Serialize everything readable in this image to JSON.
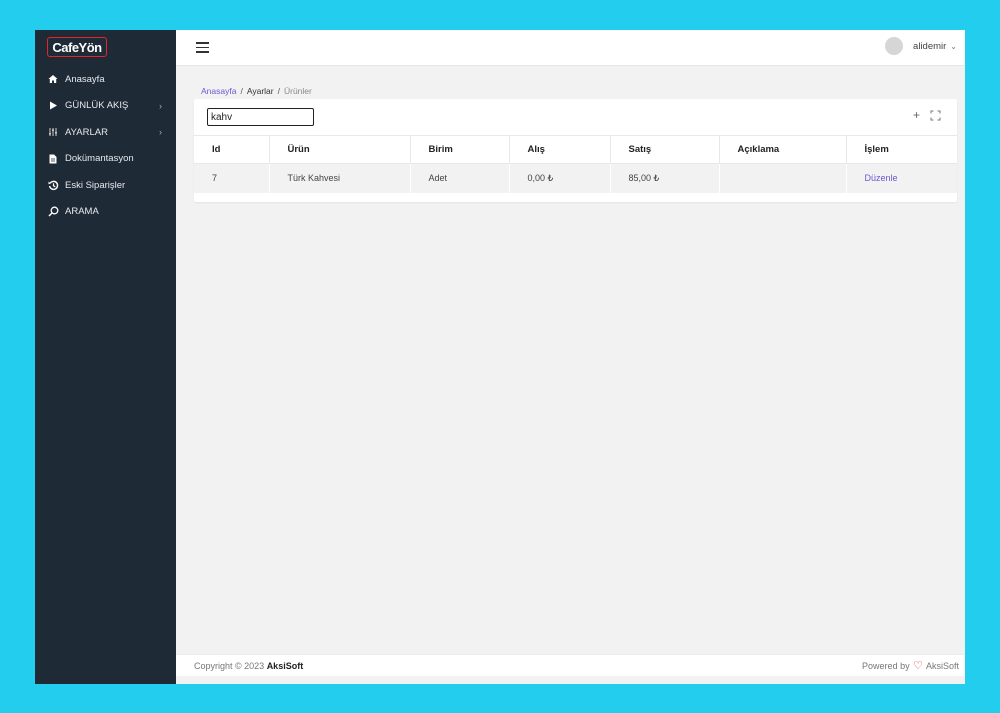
{
  "brand": {
    "logo_text": "CafeYön"
  },
  "sidebar": {
    "items": [
      {
        "label": "Anasayfa",
        "icon": "home-icon",
        "chevron": ""
      },
      {
        "label": "GÜNLÜK AKIŞ",
        "icon": "play-icon",
        "chevron": "›"
      },
      {
        "label": "AYARLAR",
        "icon": "sliders-icon",
        "chevron": "›"
      },
      {
        "label": "Dokümantasyon",
        "icon": "document-icon",
        "chevron": ""
      },
      {
        "label": "Eski Siparişler",
        "icon": "history-icon",
        "chevron": ""
      },
      {
        "label": "ARAMA",
        "icon": "search-icon",
        "chevron": ""
      }
    ]
  },
  "topbar": {
    "username": "alidemir",
    "caret": "⌄"
  },
  "breadcrumb": {
    "home": "Anasayfa",
    "settings": "Ayarlar",
    "current": "Ürünler",
    "separator": "/"
  },
  "toolbar": {
    "search_value": "kahv",
    "add_symbol": "+",
    "fullscreen_symbol": "⛶"
  },
  "table": {
    "headers": [
      "Id",
      "Ürün",
      "Birim",
      "Alış",
      "Satış",
      "Açıklama",
      "İşlem"
    ],
    "rows": [
      {
        "id": "7",
        "product": "Türk Kahvesi",
        "unit": "Adet",
        "buy": "0,00 ₺",
        "sell": "85,00 ₺",
        "description": "",
        "action": "Düzenle"
      }
    ]
  },
  "footer": {
    "copyright": "Copyright © 2023",
    "company": "AksiSoft",
    "powered_by": "Powered by",
    "powered_company": "AksiSoft",
    "heart": "♡"
  },
  "colors": {
    "sidebar_bg": "#1f2a37",
    "accent": "#6a5acd",
    "brand_red": "#e0262d",
    "page_bg": "#22cdee"
  }
}
